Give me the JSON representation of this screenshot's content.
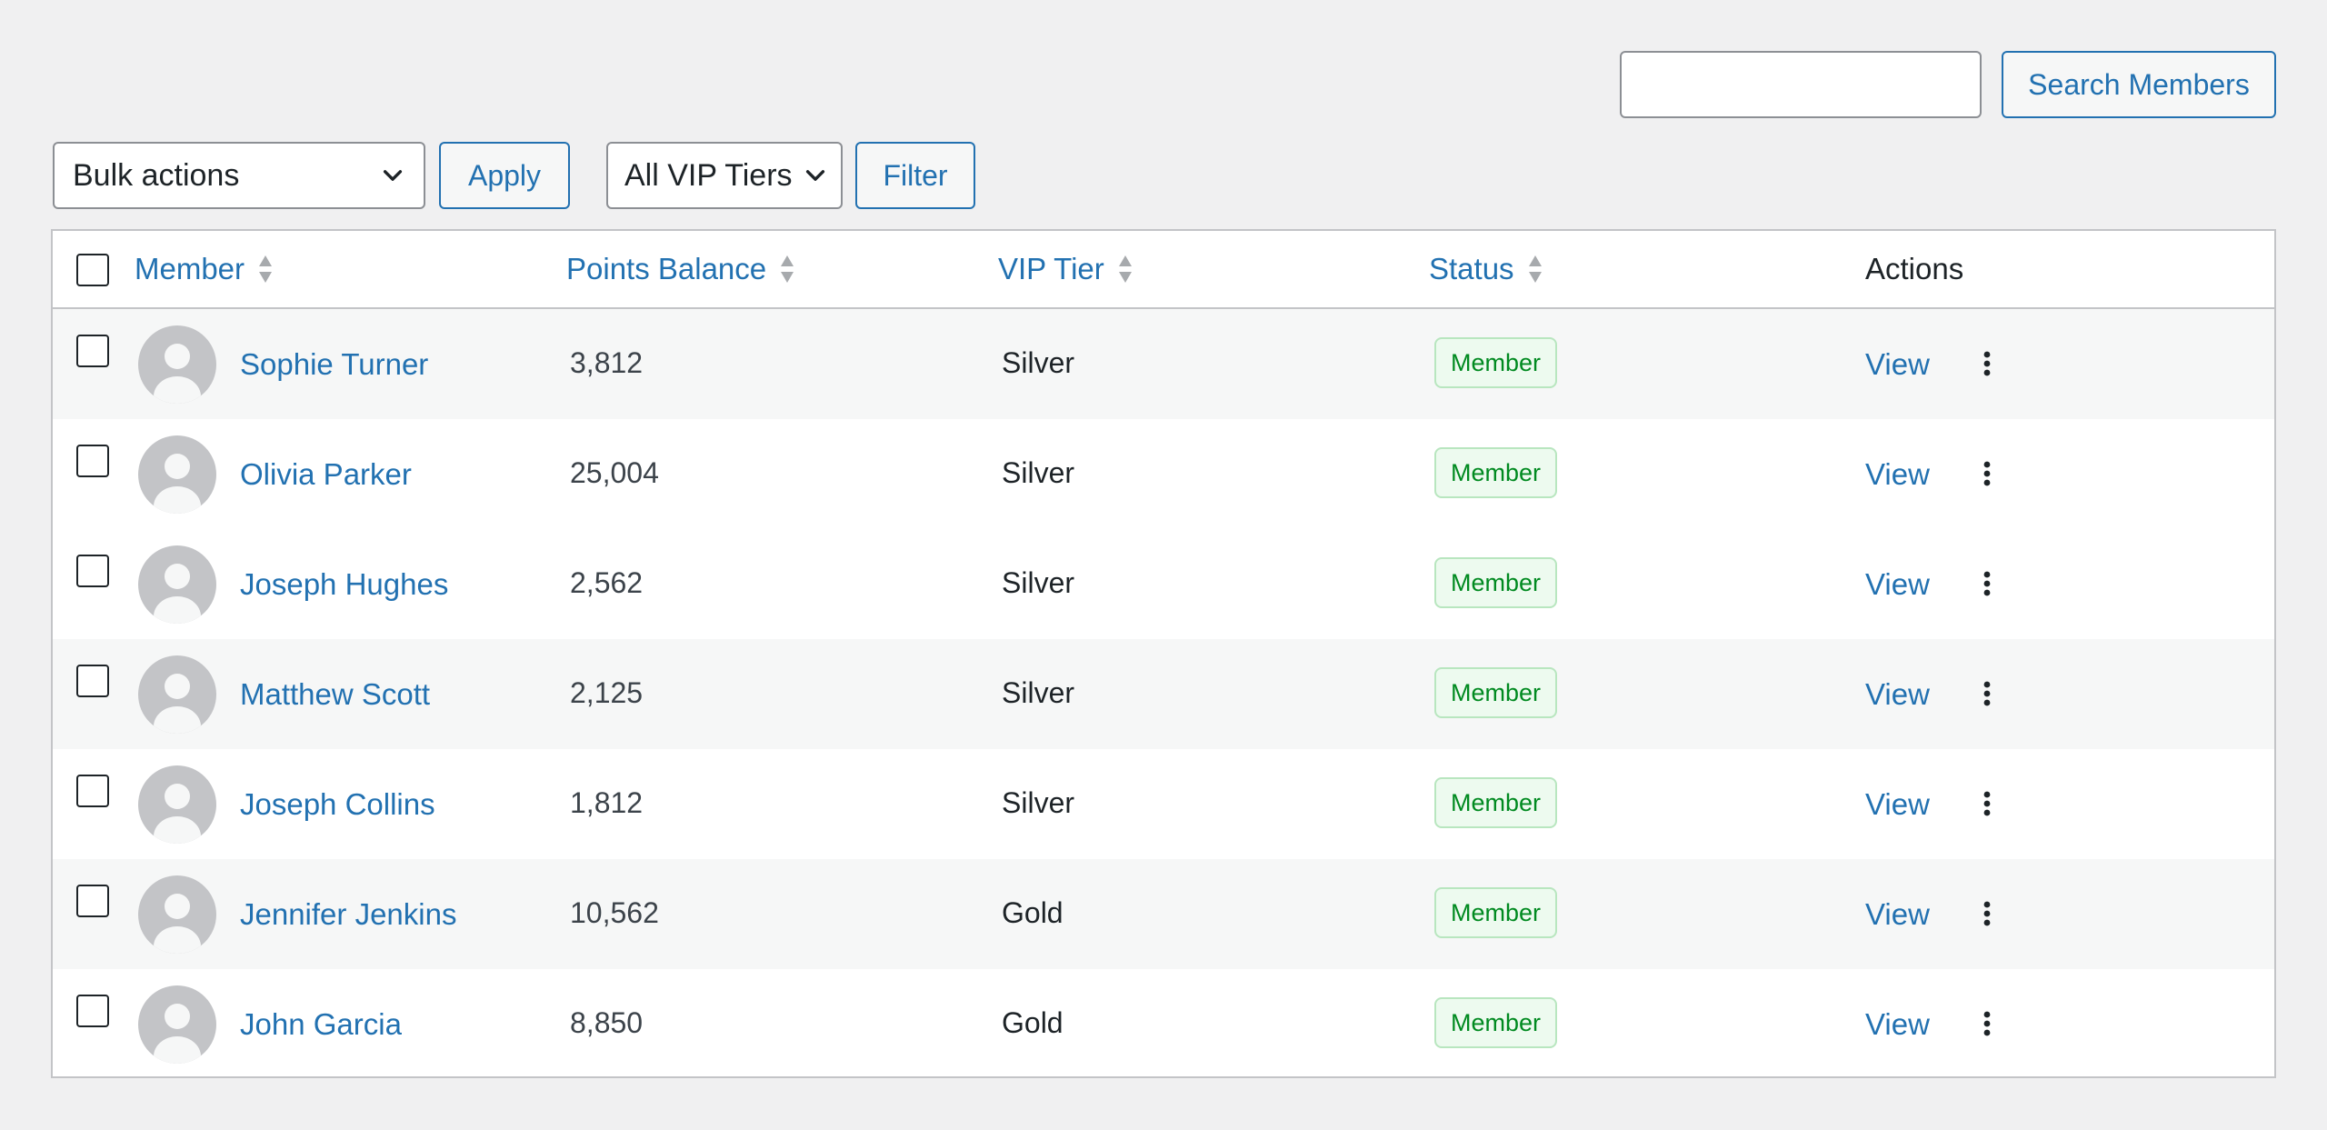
{
  "search": {
    "value": "",
    "button_label": "Search Members"
  },
  "bulk": {
    "selected": "Bulk actions",
    "apply_label": "Apply"
  },
  "tier_filter": {
    "selected": "All VIP Tiers",
    "filter_label": "Filter"
  },
  "table": {
    "headers": {
      "member": "Member",
      "points": "Points Balance",
      "tier": "VIP Tier",
      "status": "Status",
      "actions": "Actions"
    },
    "action_label": "View",
    "rows": [
      {
        "name": "Sophie Turner",
        "points": "3,812",
        "tier": "Silver",
        "status": "Member"
      },
      {
        "name": "Olivia Parker",
        "points": "25,004",
        "tier": "Silver",
        "status": "Member"
      },
      {
        "name": "Joseph Hughes",
        "points": "2,562",
        "tier": "Silver",
        "status": "Member"
      },
      {
        "name": "Matthew Scott",
        "points": "2,125",
        "tier": "Silver",
        "status": "Member"
      },
      {
        "name": "Joseph Collins",
        "points": "1,812",
        "tier": "Silver",
        "status": "Member"
      },
      {
        "name": "Jennifer Jenkins",
        "points": "10,562",
        "tier": "Gold",
        "status": "Member"
      },
      {
        "name": "John Garcia",
        "points": "8,850",
        "tier": "Gold",
        "status": "Member"
      }
    ]
  },
  "colors": {
    "accent": "#2271b1",
    "status_text": "#008a20",
    "status_bg": "#edfaef",
    "page_bg": "#f0f0f1"
  },
  "icons": {
    "select_arrow": "chevron-down-icon",
    "sort": "sort-arrows-icon",
    "avatar": "user-avatar-icon",
    "row_menu": "more-vertical-icon"
  }
}
